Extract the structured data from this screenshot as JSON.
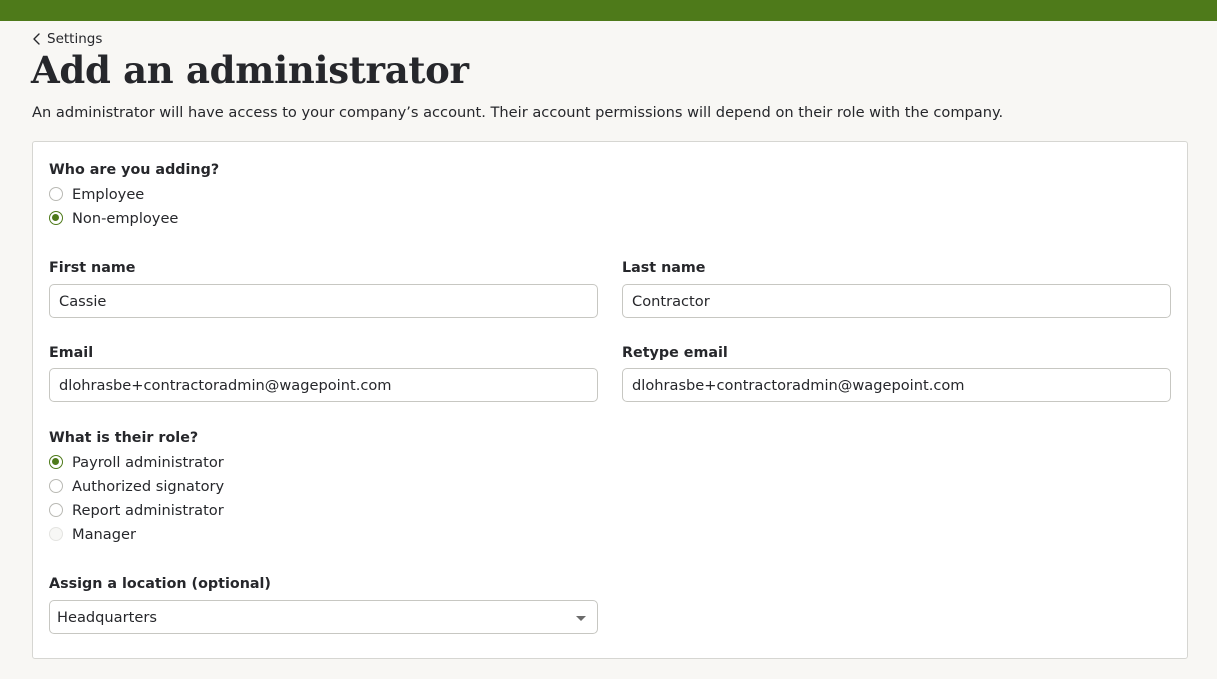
{
  "app": {
    "accent_color": "#4e7a1a"
  },
  "nav": {
    "back_label": "Settings",
    "back_icon": "chevron-left-icon"
  },
  "page": {
    "title": "Add an administrator",
    "description": "An administrator will have access to your company’s account. Their account permissions will depend on their role with the company."
  },
  "form": {
    "who_label": "Who are you adding?",
    "who_options": [
      {
        "label": "Employee",
        "checked": false
      },
      {
        "label": "Non-employee",
        "checked": true
      }
    ],
    "first_name_label": "First name",
    "first_name_value": "Cassie",
    "last_name_label": "Last name",
    "last_name_value": "Contractor",
    "email_label": "Email",
    "email_value": "dlohrasbe+contractoradmin@wagepoint.com",
    "retype_email_label": "Retype email",
    "retype_email_value": "dlohrasbe+contractoradmin@wagepoint.com",
    "role_label": "What is their role?",
    "role_options": [
      {
        "label": "Payroll administrator",
        "checked": true,
        "disabled": false
      },
      {
        "label": "Authorized signatory",
        "checked": false,
        "disabled": false
      },
      {
        "label": "Report administrator",
        "checked": false,
        "disabled": false
      },
      {
        "label": "Manager",
        "checked": false,
        "disabled": true
      }
    ],
    "location_label": "Assign a location (optional)",
    "location_value": "Headquarters",
    "location_icon": "caret-down-icon"
  }
}
